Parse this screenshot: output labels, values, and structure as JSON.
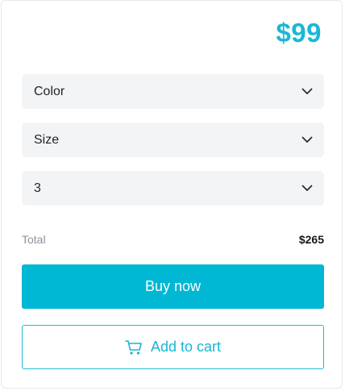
{
  "product": {
    "price": "$99"
  },
  "selectors": [
    {
      "label": "Color",
      "icon": "chevron-down-icon"
    },
    {
      "label": "Size",
      "icon": "chevron-down-icon"
    },
    {
      "label": "3",
      "icon": "chevron-down-icon"
    }
  ],
  "summary": {
    "total_label": "Total",
    "total_value": "$265"
  },
  "actions": {
    "buy_label": "Buy now",
    "cart_label": "Add to cart",
    "cart_icon": "shopping-cart-icon"
  },
  "colors": {
    "accent": "#00b7d4",
    "field_bg": "#f3f4f6"
  }
}
